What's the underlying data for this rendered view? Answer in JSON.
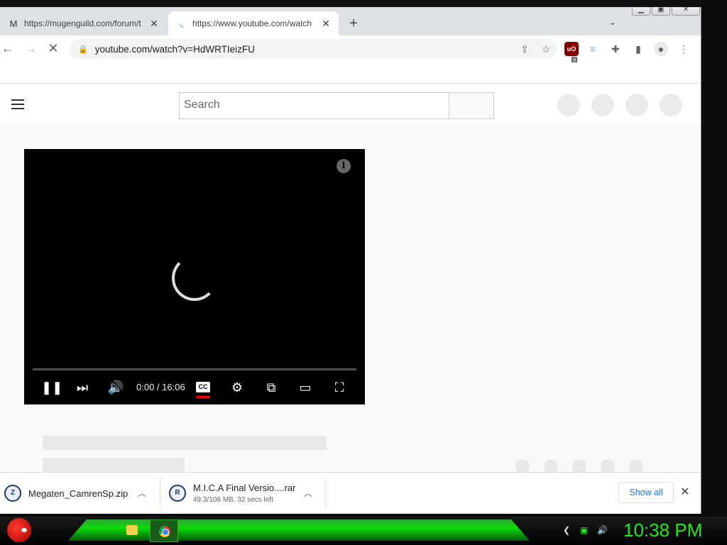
{
  "browser": {
    "tabs": [
      {
        "title": "https://mugenguild.com/forum/t",
        "favicon": "M"
      },
      {
        "title": "https://www.youtube.com/watch"
      }
    ],
    "new_tab": "+",
    "tab_search": "⌄",
    "url": "youtube.com/watch?v=HdWRTIeizFU",
    "shield_label": "uO",
    "shield_badge": "6"
  },
  "youtube": {
    "search_placeholder": "Search",
    "player": {
      "time": "0:00 / 16:06",
      "cc_label": "CC",
      "info": "i"
    }
  },
  "downloads": [
    {
      "name": "Megaten_CamrenSp.zip",
      "icon": "Z"
    },
    {
      "name": "M.I.C.A Final Versio....rar",
      "status": "49.3/108 MB, 32 secs left",
      "icon": "R"
    }
  ],
  "show_all": "Show all",
  "taskbar": {
    "clock": "10:38 PM"
  }
}
